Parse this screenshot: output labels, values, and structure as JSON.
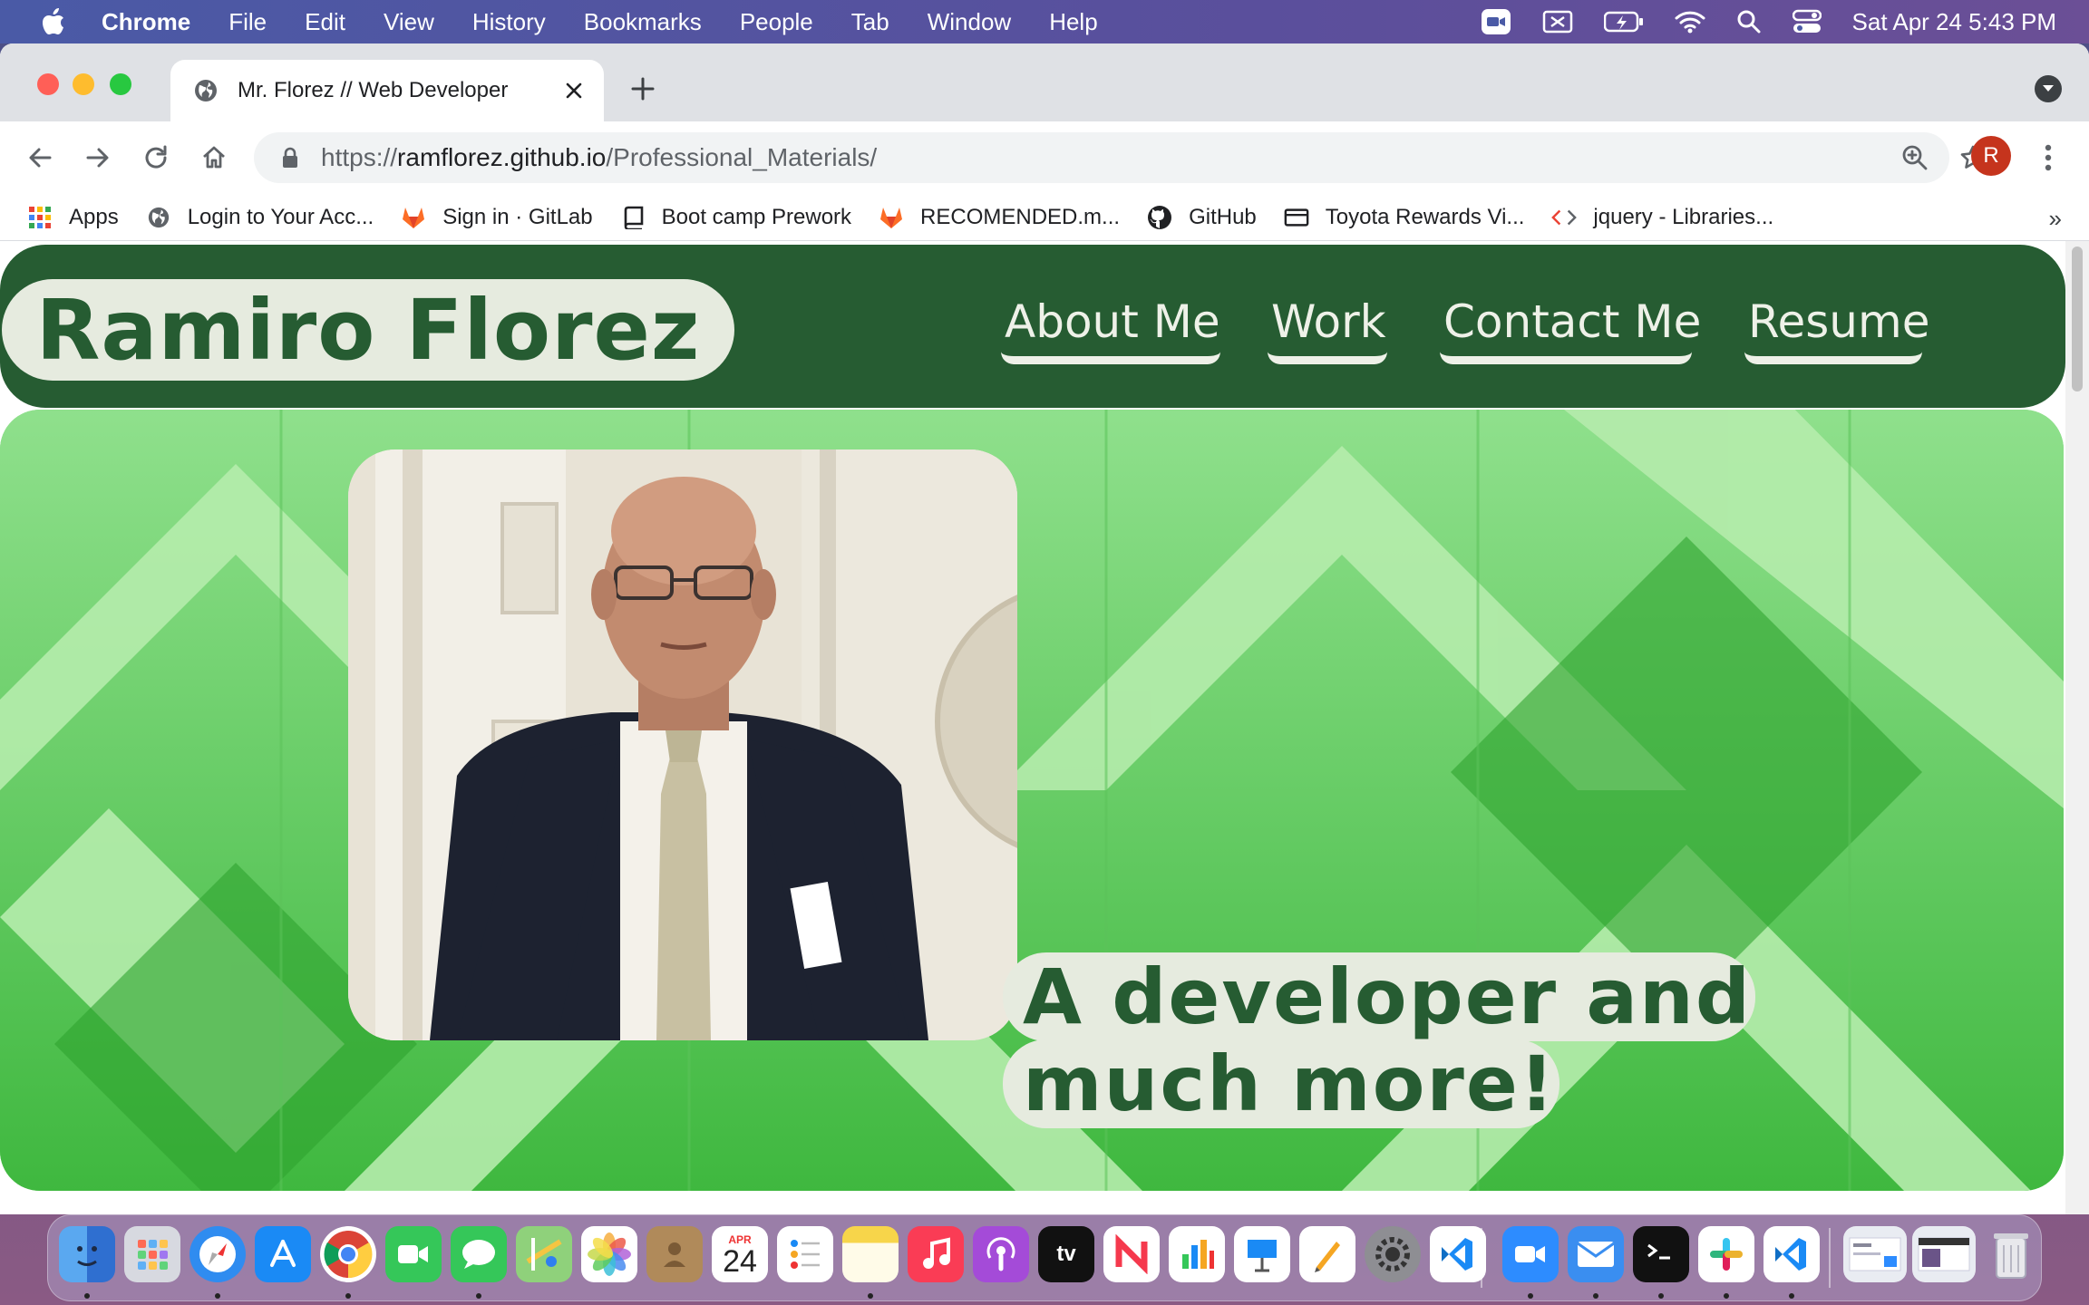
{
  "menubar": {
    "app_name": "Chrome",
    "menus": [
      "File",
      "Edit",
      "View",
      "History",
      "Bookmarks",
      "People",
      "Tab",
      "Window",
      "Help"
    ],
    "clock": "Sat Apr 24  5:43 PM"
  },
  "tab": {
    "title": "Mr. Florez // Web Developer"
  },
  "address_bar": {
    "scheme": "https://",
    "host": "ramflorez.github.io",
    "path": "/Professional_Materials/"
  },
  "profile": {
    "initial": "R"
  },
  "bookmarks": [
    {
      "label": "Apps",
      "icon": "apps-grid-icon"
    },
    {
      "label": "Login to Your Acc...",
      "icon": "globe-icon"
    },
    {
      "label": "Sign in · GitLab",
      "icon": "gitlab-icon"
    },
    {
      "label": "Boot camp Prework",
      "icon": "book-icon"
    },
    {
      "label": "RECOMENDED.m...",
      "icon": "gitlab-icon"
    },
    {
      "label": "GitHub",
      "icon": "github-icon"
    },
    {
      "label": "Toyota Rewards Vi...",
      "icon": "card-icon"
    },
    {
      "label": "jquery - Libraries...",
      "icon": "code-icon"
    }
  ],
  "site": {
    "name": "Ramiro Florez",
    "nav": [
      "About Me",
      "Work",
      "Contact Me",
      "Resume"
    ],
    "tagline": "A developer and much more!",
    "colors": {
      "dark_green": "#265c32",
      "cream": "#e6ebdf",
      "hero_green": "#6fd06f"
    }
  },
  "dock": {
    "calendar_month": "APR",
    "calendar_day": "24",
    "tv_label": "tv"
  }
}
